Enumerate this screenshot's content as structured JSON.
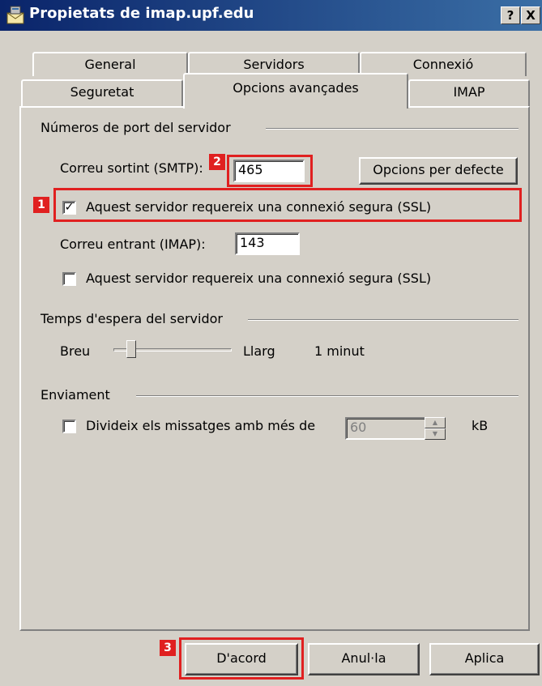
{
  "window": {
    "title": "Propietats de imap.upf.edu",
    "help_label": "?",
    "close_label": "X",
    "title_icon": "mail-server-icon"
  },
  "tabs": {
    "row1": [
      "General",
      "Servidors",
      "Connexió"
    ],
    "row2": [
      "Seguretat",
      "Opcions avançades",
      "IMAP"
    ],
    "active": "Opcions avançades"
  },
  "ports": {
    "group_label": "Números de port del servidor",
    "smtp_label": "Correu sortint (SMTP):",
    "smtp_value": "465",
    "defaults_button": "Opcions per defecte",
    "smtp_ssl_label": "Aquest servidor requereix una connexió segura (SSL)",
    "smtp_ssl_checked": true,
    "imap_label": "Correu entrant (IMAP):",
    "imap_value": "143",
    "imap_ssl_label": "Aquest servidor requereix una connexió segura (SSL)",
    "imap_ssl_checked": false
  },
  "timeout": {
    "group_label": "Temps d'espera del servidor",
    "short_label": "Breu",
    "long_label": "Llarg",
    "value_label": "1 minut",
    "slider_fraction": 0.12
  },
  "sending": {
    "group_label": "Enviament",
    "split_label": "Divideix els missatges amb més de",
    "split_checked": false,
    "split_value": "60",
    "unit": "kB"
  },
  "buttons": {
    "ok": "D'acord",
    "cancel": "Anul·la",
    "apply": "Aplica"
  },
  "annotations": [
    "1",
    "2",
    "3"
  ],
  "colors": {
    "titlebar": "#0a246a",
    "highlight": "#e02020",
    "face": "#d4d0c8"
  }
}
